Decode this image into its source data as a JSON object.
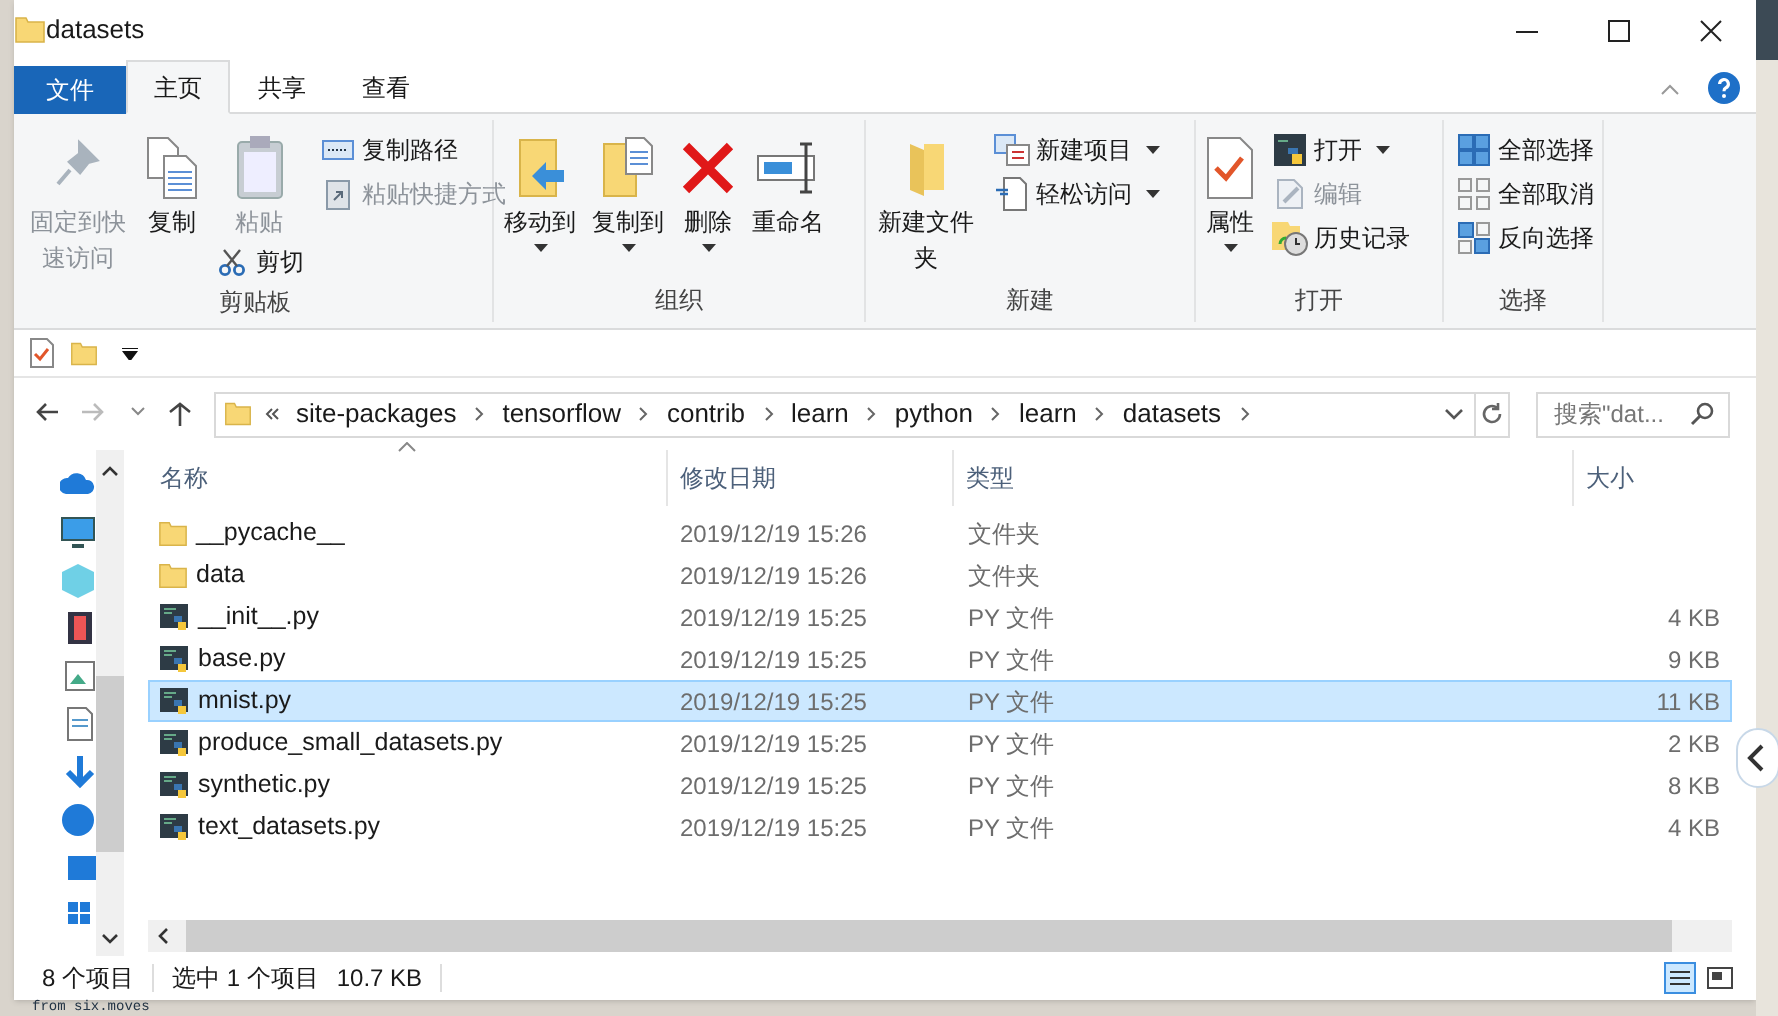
{
  "window": {
    "title": "datasets"
  },
  "ribbon": {
    "tabs": [
      {
        "label": "文件",
        "kind": "file",
        "selected": false
      },
      {
        "label": "主页",
        "kind": "tab",
        "selected": true
      },
      {
        "label": "共享",
        "kind": "tab",
        "selected": false
      },
      {
        "label": "查看",
        "kind": "tab",
        "selected": false
      }
    ],
    "groups": [
      {
        "label": "剪贴板",
        "items": [
          {
            "label": "固定到快速访问",
            "kind": "large",
            "disabled": true,
            "dropdown": false
          },
          {
            "label": "复制",
            "kind": "large",
            "disabled": false,
            "dropdown": false
          },
          {
            "label": "粘贴",
            "kind": "large",
            "disabled": true,
            "dropdown": false
          },
          {
            "label": "剪切",
            "kind": "under",
            "disabled": false,
            "dropdown": false
          },
          {
            "label": "复制路径",
            "kind": "small",
            "disabled": false,
            "dropdown": false
          },
          {
            "label": "粘贴快捷方式",
            "kind": "small",
            "disabled": true,
            "dropdown": false
          }
        ]
      },
      {
        "label": "组织",
        "items": [
          {
            "label": "移动到",
            "kind": "large",
            "disabled": false,
            "dropdown": true
          },
          {
            "label": "复制到",
            "kind": "large",
            "disabled": false,
            "dropdown": true
          },
          {
            "label": "删除",
            "kind": "large",
            "disabled": false,
            "dropdown": true
          },
          {
            "label": "重命名",
            "kind": "large",
            "disabled": false,
            "dropdown": false
          }
        ]
      },
      {
        "label": "新建",
        "items": [
          {
            "label": "新建文件夹",
            "kind": "large",
            "disabled": false,
            "dropdown": false
          },
          {
            "label": "新建项目",
            "kind": "small",
            "disabled": false,
            "dropdown": true
          },
          {
            "label": "轻松访问",
            "kind": "small",
            "disabled": false,
            "dropdown": true
          }
        ]
      },
      {
        "label": "打开",
        "items": [
          {
            "label": "属性",
            "kind": "large",
            "disabled": false,
            "dropdown": true
          },
          {
            "label": "打开",
            "kind": "small",
            "disabled": false,
            "dropdown": true
          },
          {
            "label": "编辑",
            "kind": "small",
            "disabled": true,
            "dropdown": false
          },
          {
            "label": "历史记录",
            "kind": "small",
            "disabled": false,
            "dropdown": false
          }
        ]
      },
      {
        "label": "选择",
        "items": [
          {
            "label": "全部选择",
            "kind": "small",
            "disabled": false,
            "dropdown": false
          },
          {
            "label": "全部取消",
            "kind": "small",
            "disabled": false,
            "dropdown": false
          },
          {
            "label": "反向选择",
            "kind": "small",
            "disabled": false,
            "dropdown": false
          }
        ]
      }
    ]
  },
  "address": {
    "path": [
      "site-packages",
      "tensorflow",
      "contrib",
      "learn",
      "python",
      "learn",
      "datasets"
    ]
  },
  "search": {
    "placeholder": "搜索\"dat..."
  },
  "table": {
    "columns": [
      {
        "label": "名称",
        "sorted": true
      },
      {
        "label": "修改日期",
        "sorted": false
      },
      {
        "label": "类型",
        "sorted": false
      },
      {
        "label": "大小",
        "sorted": false
      }
    ],
    "rows": [
      {
        "kind": "folder",
        "name": "__pycache__",
        "date": "2019/12/19 15:26",
        "type": "文件夹",
        "selected": false
      },
      {
        "kind": "folder",
        "name": "data",
        "date": "2019/12/19 15:26",
        "type": "文件夹",
        "selected": false
      },
      {
        "kind": "python",
        "name": "__init__.py",
        "date": "2019/12/19 15:25",
        "type": "PY 文件",
        "size": "4 KB",
        "selected": false
      },
      {
        "kind": "python",
        "name": "base.py",
        "date": "2019/12/19 15:25",
        "type": "PY 文件",
        "size": "9 KB",
        "selected": false
      },
      {
        "kind": "python",
        "name": "mnist.py",
        "date": "2019/12/19 15:25",
        "type": "PY 文件",
        "size": "11 KB",
        "selected": true
      },
      {
        "kind": "python",
        "name": "produce_small_datasets.py",
        "date": "2019/12/19 15:25",
        "type": "PY 文件",
        "size": "2 KB",
        "selected": false
      },
      {
        "kind": "python",
        "name": "synthetic.py",
        "date": "2019/12/19 15:25",
        "type": "PY 文件",
        "size": "8 KB",
        "selected": false
      },
      {
        "kind": "python",
        "name": "text_datasets.py",
        "date": "2019/12/19 15:25",
        "type": "PY 文件",
        "size": "4 KB",
        "selected": false
      }
    ]
  },
  "status_bar": {
    "count": "8 个项目",
    "selection": "选中 1 个项目",
    "size": "10.7 KB"
  },
  "background": {
    "code_text": "from six.moves"
  }
}
